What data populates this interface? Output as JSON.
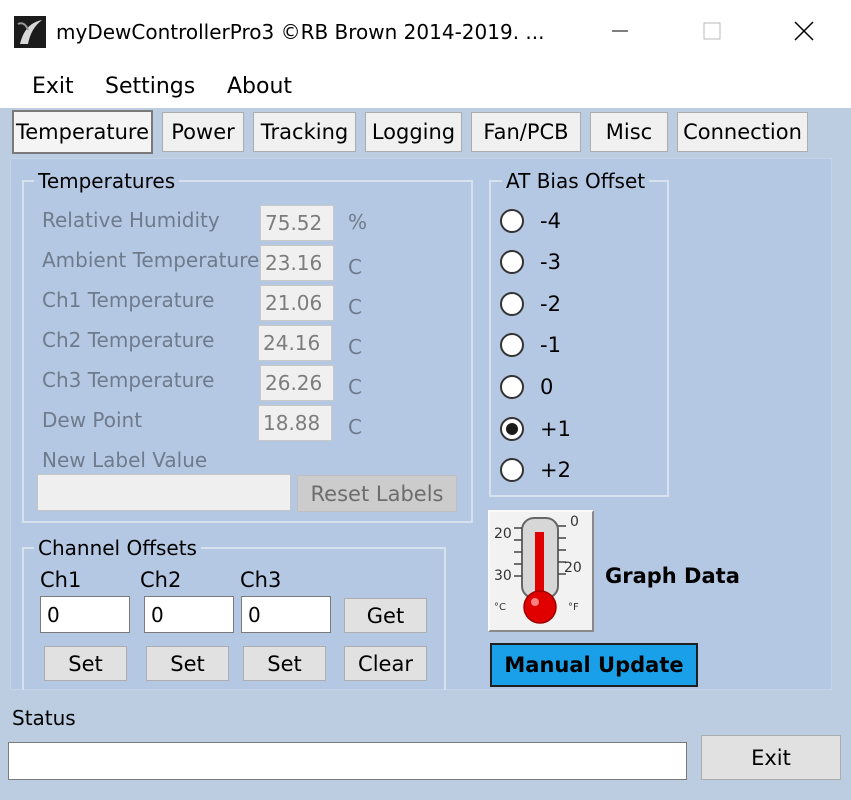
{
  "window": {
    "title": "myDewControllerPro3 ©RB Brown 2014-2019. ..."
  },
  "menu": {
    "items": [
      "Exit",
      "Settings",
      "About"
    ]
  },
  "tabs": [
    "Temperature",
    "Power",
    "Tracking",
    "Logging",
    "Fan/PCB",
    "Misc",
    "Connection"
  ],
  "temperatures": {
    "group_title": "Temperatures",
    "rows": [
      {
        "label": "Relative Humidity",
        "value": "75.52",
        "unit": "%"
      },
      {
        "label": "Ambient Temperature",
        "value": "23.16",
        "unit": "C"
      },
      {
        "label": "Ch1 Temperature",
        "value": "21.06",
        "unit": "C"
      },
      {
        "label": "Ch2 Temperature",
        "value": "24.16",
        "unit": "C"
      },
      {
        "label": "Ch3 Temperature",
        "value": "26.26",
        "unit": "C"
      },
      {
        "label": "Dew Point",
        "value": "18.88",
        "unit": "C"
      }
    ],
    "new_label_caption": "New Label Value",
    "new_label_value": "",
    "reset_labels": "Reset Labels"
  },
  "at_bias": {
    "group_title": "AT Bias Offset",
    "options": [
      "-4",
      "-3",
      "-2",
      "-1",
      "0",
      "+1",
      "+2"
    ],
    "selected": "+1"
  },
  "channel_offsets": {
    "group_title": "Channel Offsets",
    "channels": [
      {
        "label": "Ch1",
        "value": "0",
        "set": "Set"
      },
      {
        "label": "Ch2",
        "value": "0",
        "set": "Set"
      },
      {
        "label": "Ch3",
        "value": "0",
        "set": "Set"
      }
    ],
    "get": "Get",
    "clear": "Clear"
  },
  "graph": {
    "icon": "thermometer-icon",
    "label": "Graph Data",
    "scale_c": [
      "20",
      "30",
      "°C"
    ],
    "scale_f": [
      "0",
      "20",
      "°F"
    ]
  },
  "manual_update": "Manual Update",
  "status": {
    "label": "Status",
    "value": "",
    "exit": "Exit"
  }
}
